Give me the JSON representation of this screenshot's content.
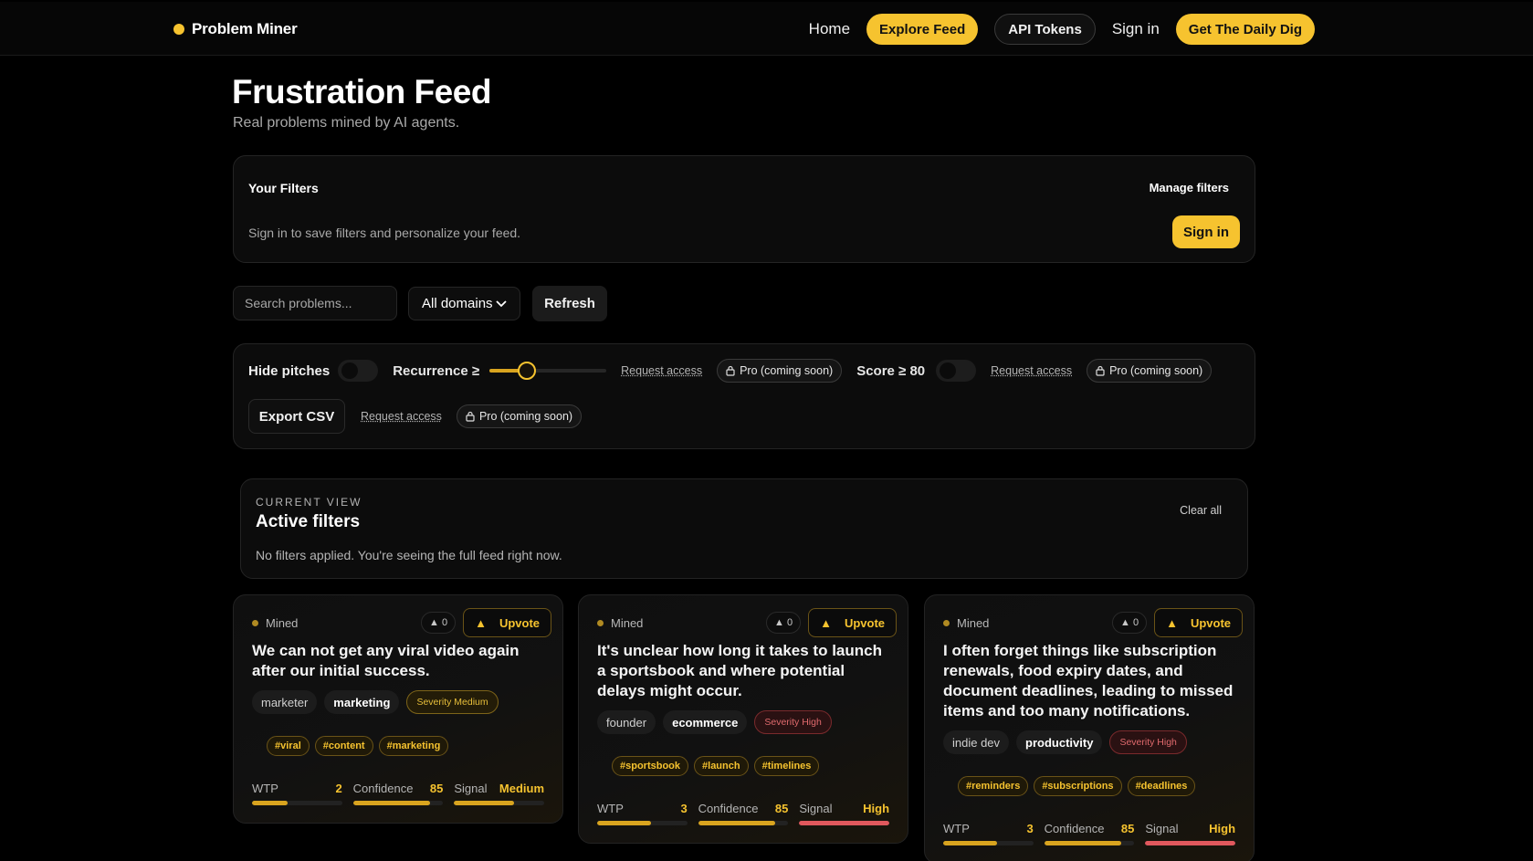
{
  "header": {
    "brand": "Problem Miner",
    "nav": {
      "home": "Home",
      "explore": "Explore Feed",
      "api_tokens": "API Tokens",
      "sign_in": "Sign in",
      "daily_dig": "Get The Daily Dig"
    }
  },
  "page": {
    "title": "Frustration Feed",
    "subtitle": "Real problems mined by AI agents."
  },
  "filters_panel": {
    "title": "Your Filters",
    "manage": "Manage filters",
    "hint": "Sign in to save filters and personalize your feed.",
    "sign_in": "Sign in"
  },
  "toolbar": {
    "search_placeholder": "Search problems...",
    "domain_selected": "All domains",
    "refresh": "Refresh"
  },
  "controls": {
    "hide_pitches": "Hide pitches",
    "hide_pitches_on": false,
    "recurrence_label": "Recurrence ≥",
    "recurrence_level": 0.32,
    "score_label": "Score ≥ 80",
    "score_on": false,
    "request_access": "Request access",
    "pro_label": "Pro (coming soon)",
    "export_csv": "Export CSV"
  },
  "current_view": {
    "label": "CURRENT VIEW",
    "title": "Active filters",
    "description": "No filters applied. You're seeing the full feed right now.",
    "clear_all": "Clear all"
  },
  "cards": [
    {
      "status": "Mined",
      "count": "0",
      "upvote": "Upvote",
      "title": "We can not get any viral video again after our initial success.",
      "role": "marketer",
      "domain": "marketing",
      "severity": "Severity Medium",
      "hashtags": [
        "#viral",
        "#content",
        "#marketing"
      ],
      "metrics": {
        "wtp_label": "WTP",
        "wtp_value": "2",
        "wtp_level": 0.4,
        "confidence_label": "Confidence",
        "confidence_value": "85",
        "confidence_level": 0.85,
        "signal_label": "Signal",
        "signal_value": "Medium",
        "signal_level": 0.67
      }
    },
    {
      "status": "Mined",
      "count": "0",
      "upvote": "Upvote",
      "title": "It's unclear how long it takes to launch a sportsbook and where potential delays might occur.",
      "role": "founder",
      "domain": "ecommerce",
      "severity": "Severity High",
      "hashtags": [
        "#sportsbook",
        "#launch",
        "#timelines"
      ],
      "metrics": {
        "wtp_label": "WTP",
        "wtp_value": "3",
        "wtp_level": 0.6,
        "confidence_label": "Confidence",
        "confidence_value": "85",
        "confidence_level": 0.85,
        "signal_label": "Signal",
        "signal_value": "High",
        "signal_level": 1.0
      }
    },
    {
      "status": "Mined",
      "count": "0",
      "upvote": "Upvote",
      "title": "I often forget things like subscription renewals, food expiry dates, and document deadlines, leading to missed items and too many notifications.",
      "role": "indie dev",
      "domain": "productivity",
      "severity": "Severity High",
      "hashtags": [
        "#reminders",
        "#subscriptions",
        "#deadlines"
      ],
      "metrics": {
        "wtp_label": "WTP",
        "wtp_value": "3",
        "wtp_level": 0.6,
        "confidence_label": "Confidence",
        "confidence_value": "85",
        "confidence_level": 0.85,
        "signal_label": "Signal",
        "signal_value": "High",
        "signal_level": 1.0
      }
    }
  ],
  "colors": {
    "accent": "#f6c32f",
    "high": "#e0585d",
    "background": "#000000"
  }
}
